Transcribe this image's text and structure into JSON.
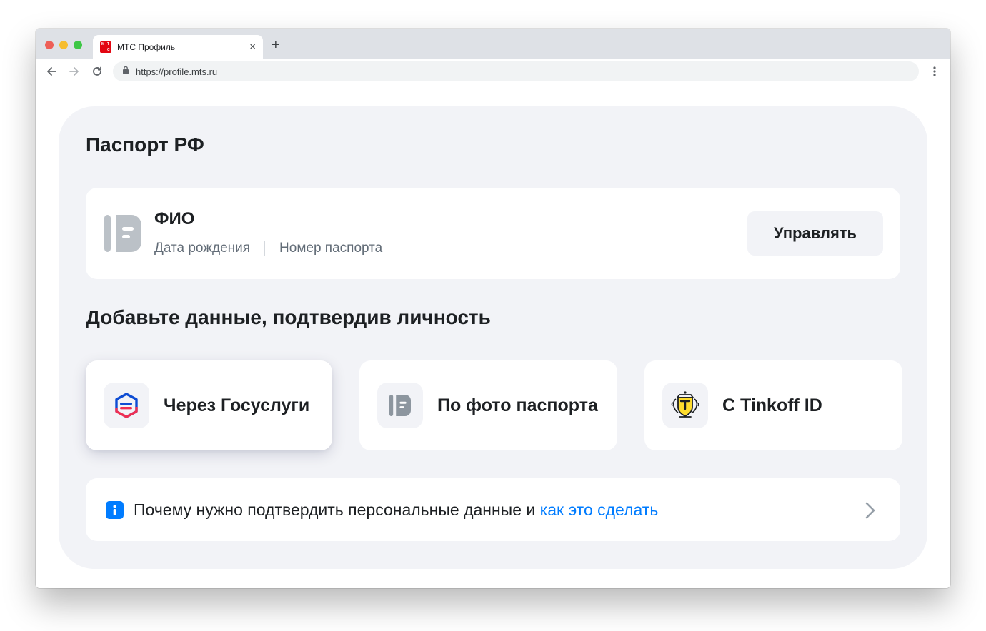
{
  "browser": {
    "tab_title": "МТС Профиль",
    "favicon_letters": [
      "М",
      "Т",
      "С"
    ],
    "close_glyph": "×",
    "new_tab_glyph": "+",
    "url": "https://profile.mts.ru"
  },
  "page": {
    "title": "Паспорт РФ",
    "passport_card": {
      "name": "ФИО",
      "birth_date_label": "Дата рождения",
      "passport_number_label": "Номер паспорта",
      "manage_button": "Управлять"
    },
    "section_title": "Добавьте данные, подтвердив личность",
    "options": [
      {
        "label": "Через Госуслуги",
        "icon": "gosuslugi-icon"
      },
      {
        "label": "По фото паспорта",
        "icon": "passport-photo-icon"
      },
      {
        "label": "С Tinkoff ID",
        "icon": "tinkoff-icon"
      }
    ],
    "info": {
      "text": "Почему нужно подтвердить персональные данные и ",
      "link": "как это сделать"
    }
  },
  "colors": {
    "accent_blue": "#007cff",
    "mts_red": "#e30611",
    "panel_bg": "#f2f3f7",
    "text_primary": "#1d2023",
    "text_secondary": "#626c77"
  }
}
